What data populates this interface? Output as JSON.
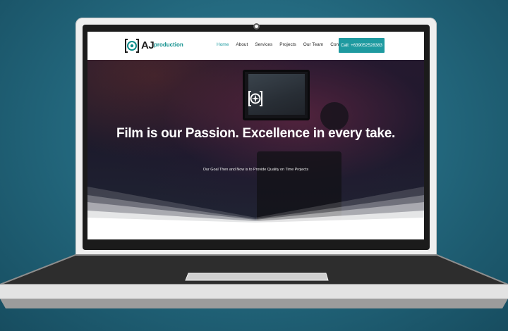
{
  "site": {
    "logo": {
      "mark": "[O]",
      "aj": "AJ",
      "suffix": "production"
    },
    "nav": [
      {
        "label": "Home",
        "active": true
      },
      {
        "label": "About",
        "active": false
      },
      {
        "label": "Services",
        "active": false
      },
      {
        "label": "Projects",
        "active": false
      },
      {
        "label": "Our Team",
        "active": false
      },
      {
        "label": "Contact Us",
        "active": false
      }
    ],
    "cta_label": "Call: +639052528383",
    "hero": {
      "title": "Film is our Passion. Excellence in every take.",
      "subtitle": "Our Goal Then and Now is to Provide Quality on Time Projects",
      "icon": "camera-shutter-icon"
    }
  },
  "colors": {
    "background": "#246a80",
    "accent": "#1e9aa0",
    "laptop_base": "#2a2a2a",
    "lid": "#efefef"
  }
}
